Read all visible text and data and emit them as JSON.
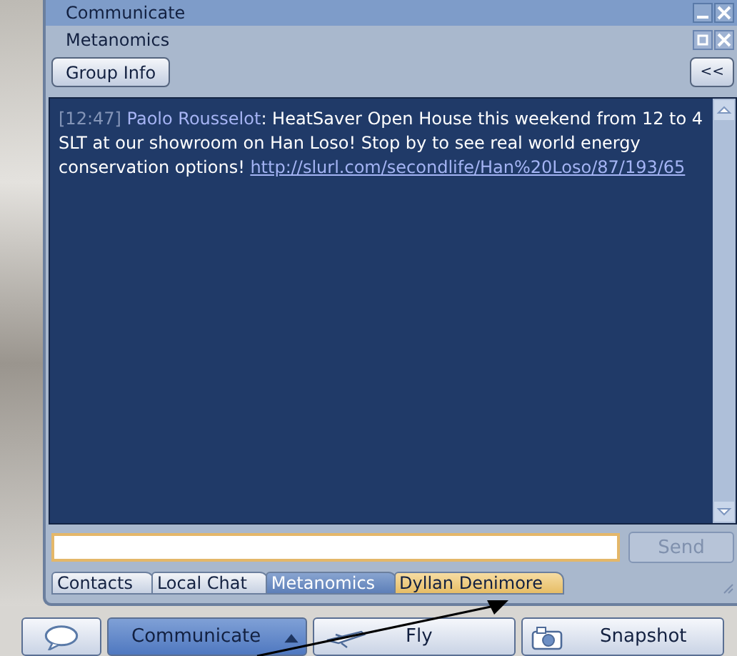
{
  "window": {
    "title": "Communicate",
    "subtitle": "Metanomics"
  },
  "group_info_button": "Group Info",
  "collapse_button": "<<",
  "message": {
    "time": "[12:47]",
    "sender": "Paolo Rousselot",
    "text": ": HeatSaver Open House this weekend from 12 to 4 SLT at our showroom on Han Loso!  Stop by to see real world energy conservation options!",
    "link": "http://slurl.com/secondlife/Han%20Loso/87/193/65"
  },
  "send_button": {
    "label": "Send",
    "disabled": true
  },
  "tabs": [
    {
      "label": "Contacts",
      "selected": false,
      "flashing": false
    },
    {
      "label": "Local Chat",
      "selected": false,
      "flashing": false
    },
    {
      "label": "Metanomics",
      "selected": true,
      "flashing": false
    },
    {
      "label": "Dyllan Denimore",
      "selected": false,
      "flashing": true
    }
  ],
  "toolbar": [
    {
      "kind": "chat",
      "selected": false
    },
    {
      "kind": "menu",
      "label": "Communicate",
      "selected": true
    },
    {
      "kind": "fly",
      "label": "Fly",
      "selected": false
    },
    {
      "kind": "snapshot",
      "label": "Snapshot",
      "selected": false
    }
  ]
}
